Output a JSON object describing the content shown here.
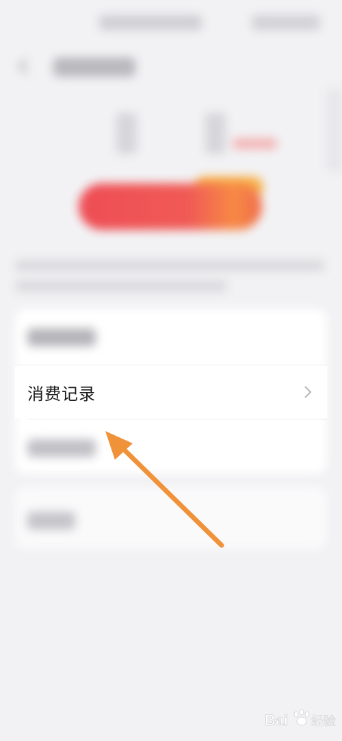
{
  "list": {
    "visible_row_label": "消费记录"
  },
  "annotation": {
    "color": "#f0923a"
  },
  "colors": {
    "action_button_start": "#ee4d55",
    "action_button_end": "#f78a45",
    "background": "#f2f2f4"
  },
  "icons": {
    "back": "back-arrow-icon",
    "row": "chevron-right-icon"
  }
}
